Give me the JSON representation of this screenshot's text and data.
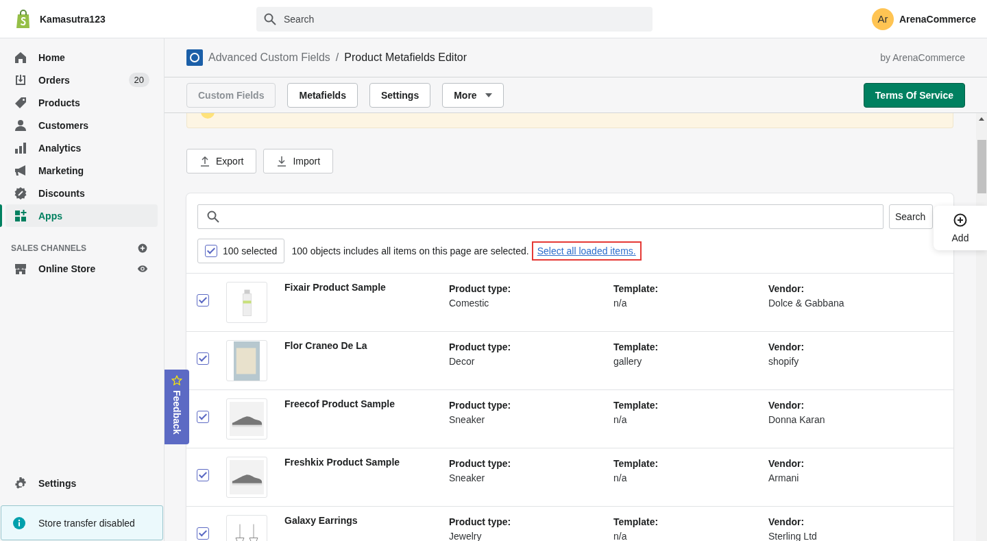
{
  "topbar": {
    "store_name": "Kamasutra123",
    "search": {
      "placeholder": "Search"
    },
    "account": {
      "initials": "Ar",
      "name": "ArenaCommerce"
    }
  },
  "sidebar": {
    "items": [
      {
        "kind": "home",
        "label": "Home",
        "selected": false
      },
      {
        "kind": "orders",
        "label": "Orders",
        "badge": "20",
        "selected": false
      },
      {
        "kind": "products",
        "label": "Products",
        "selected": false
      },
      {
        "kind": "customers",
        "label": "Customers",
        "selected": false
      },
      {
        "kind": "analytics",
        "label": "Analytics",
        "selected": false
      },
      {
        "kind": "marketing",
        "label": "Marketing",
        "selected": false
      },
      {
        "kind": "discounts",
        "label": "Discounts",
        "selected": false
      },
      {
        "kind": "apps",
        "label": "Apps",
        "selected": true
      }
    ],
    "channels_heading": "SALES CHANNELS",
    "channels": [
      {
        "kind": "store",
        "label": "Online Store",
        "selected": false
      }
    ],
    "settings": "Settings",
    "notice": "Store transfer disabled"
  },
  "app_header": {
    "app_name": "Advanced Custom Fields",
    "separator": "/",
    "page_title": "Product Metafields Editor",
    "byline": "by ArenaCommerce"
  },
  "tabs": [
    {
      "label": "Custom Fields",
      "selected": true
    },
    {
      "label": "Metafields",
      "selected": false
    },
    {
      "label": "Settings",
      "selected": false
    },
    {
      "label": "More",
      "selected": false,
      "dropdown": true
    }
  ],
  "terms_button": "Terms Of Service",
  "actions": [
    {
      "kind": "export",
      "label": "Export"
    },
    {
      "kind": "import",
      "label": "Import"
    }
  ],
  "list": {
    "search_button": "Search",
    "selection": {
      "checked": true,
      "label": "100 selected",
      "message": "100 objects includes all items on this page are selected.",
      "link": "Select all loaded items."
    },
    "rows": [
      {
        "checked": true,
        "kind": "bottle",
        "name": "Fixair Product Sample",
        "type_label": "Product type:",
        "type": "Comestic",
        "template_label": "Template:",
        "template": "n/a",
        "vendor_label": "Vendor:",
        "vendor": "Dolce & Gabbana"
      },
      {
        "checked": true,
        "kind": "photo",
        "name": "Flor Craneo De La",
        "type_label": "Product type:",
        "type": "Decor",
        "template_label": "Template:",
        "template": "gallery",
        "vendor_label": "Vendor:",
        "vendor": "shopify"
      },
      {
        "checked": true,
        "kind": "shoe",
        "name": "Freecof Product Sample",
        "type_label": "Product type:",
        "type": "Sneaker",
        "template_label": "Template:",
        "template": "n/a",
        "vendor_label": "Vendor:",
        "vendor": "Donna Karan"
      },
      {
        "checked": true,
        "kind": "shoe",
        "name": "Freshkix Product Sample",
        "type_label": "Product type:",
        "type": "Sneaker",
        "template_label": "Template:",
        "template": "n/a",
        "vendor_label": "Vendor:",
        "vendor": "Armani"
      },
      {
        "checked": true,
        "kind": "earrings",
        "name": "Galaxy Earrings",
        "type_label": "Product type:",
        "type": "Jewelry",
        "template_label": "Template:",
        "template": "n/a",
        "vendor_label": "Vendor:",
        "vendor": "Sterling Ltd"
      }
    ]
  },
  "feedback": "Feedback",
  "add_button": "Add"
}
